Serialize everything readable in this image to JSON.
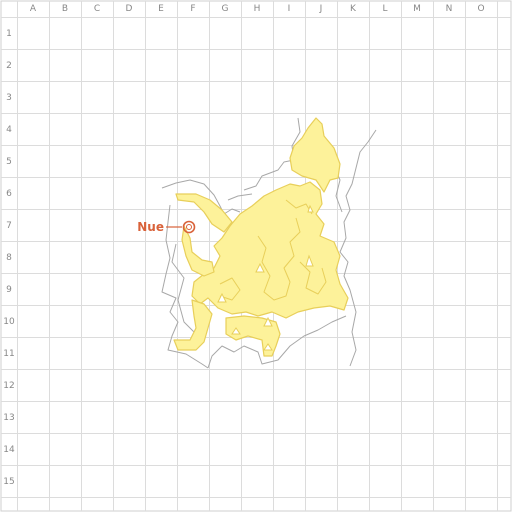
{
  "grid": {
    "columns": [
      "A",
      "B",
      "C",
      "D",
      "E",
      "F",
      "G",
      "H",
      "I",
      "J",
      "K",
      "L",
      "M",
      "N",
      "O"
    ],
    "rows": [
      "1",
      "2",
      "3",
      "4",
      "5",
      "6",
      "7",
      "8",
      "9",
      "10",
      "11",
      "12",
      "13",
      "14",
      "15"
    ]
  },
  "marker": {
    "label": "Nue",
    "cell": "F7",
    "color": "#d9623a",
    "icon": "ring-marker-icon"
  },
  "colors": {
    "grid": "#dcdcdc",
    "terrain_fill": "#fdf29a",
    "terrain_edge": "#e8cf5a",
    "cliff_line": "#a8a8a8",
    "label_text": "#888888"
  }
}
